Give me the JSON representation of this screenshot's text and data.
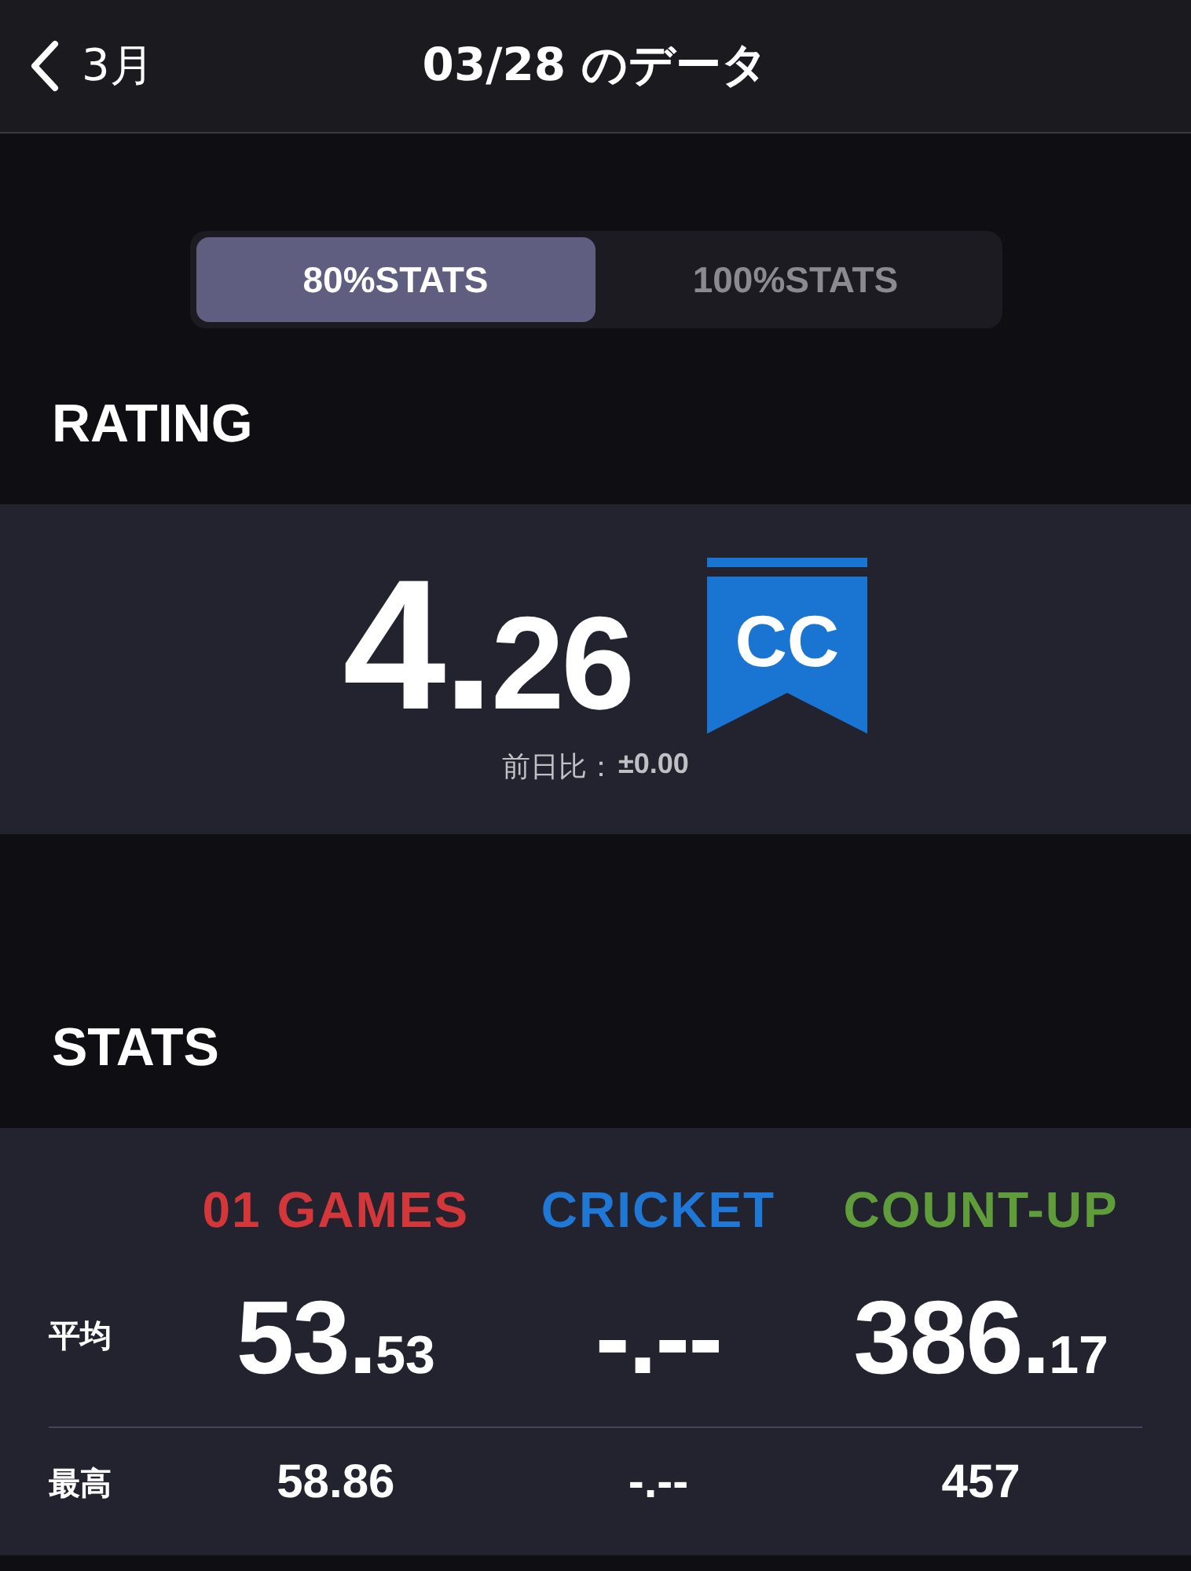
{
  "nav": {
    "back_label": "3月",
    "title": "03/28 のデータ"
  },
  "segments": [
    {
      "label": "80%STATS",
      "selected": true
    },
    {
      "label": "100%STATS",
      "selected": false
    }
  ],
  "rating": {
    "heading": "RATING",
    "main": "4.",
    "fraction": "26",
    "rank": "CC",
    "change_label": "前日比：",
    "change": "±0.00"
  },
  "stats": {
    "heading": "STATS",
    "columns": [
      {
        "title": "01 GAMES",
        "color": "#d3373a"
      },
      {
        "title": "CRICKET",
        "color": "#1f77d6"
      },
      {
        "title": "COUNT-UP",
        "color": "#5f9d3a"
      }
    ],
    "rows": [
      {
        "kind": "large",
        "label": "平均",
        "values": [
          {
            "main": "53.",
            "fraction": "53"
          },
          {
            "main": "-.--"
          },
          {
            "main": "386.",
            "fraction": "17"
          }
        ]
      },
      {
        "kind": "small",
        "label": "最高",
        "values": [
          {
            "main": "58.86"
          },
          {
            "main": "-.--"
          },
          {
            "main": "457"
          }
        ]
      }
    ]
  }
}
